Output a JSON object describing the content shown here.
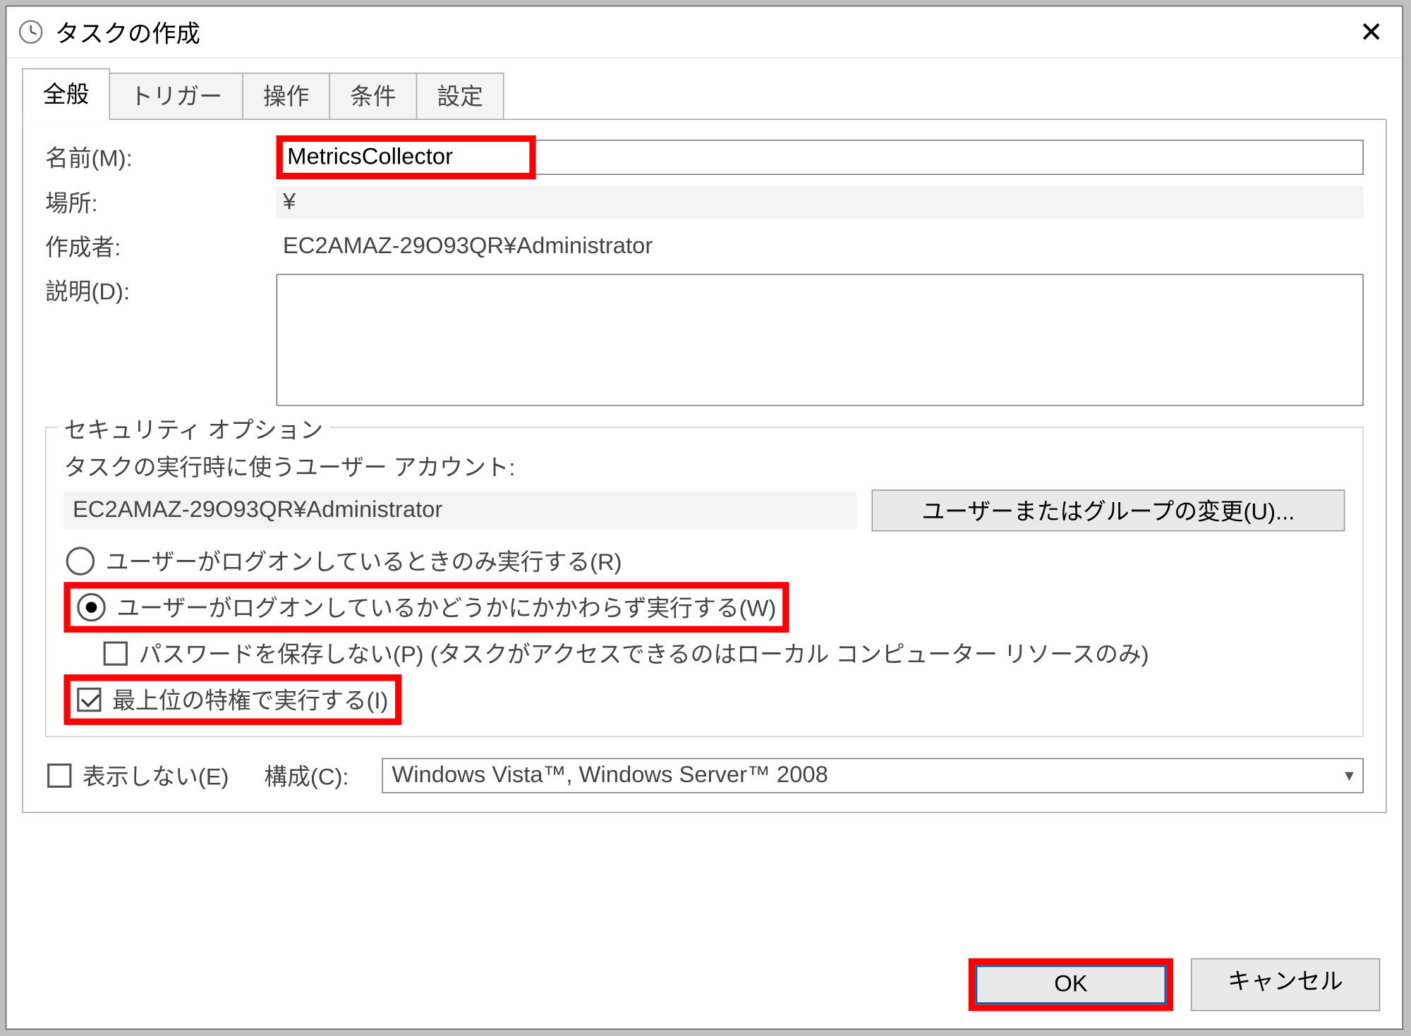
{
  "window": {
    "title": "タスクの作成"
  },
  "tabs": {
    "items": [
      "全般",
      "トリガー",
      "操作",
      "条件",
      "設定"
    ],
    "active_index": 0
  },
  "general": {
    "name": {
      "label": "名前(M):",
      "value": "MetricsCollector"
    },
    "location": {
      "label": "場所:",
      "value": "¥"
    },
    "author": {
      "label": "作成者:",
      "value": "EC2AMAZ-29O93QR¥Administrator"
    },
    "description": {
      "label": "説明(D):",
      "value": ""
    }
  },
  "security": {
    "legend": "セキュリティ オプション",
    "account_label": "タスクの実行時に使うユーザー アカウント:",
    "account_value": "EC2AMAZ-29O93QR¥Administrator",
    "change_user_button": "ユーザーまたはグループの変更(U)...",
    "run_only_logged_on": {
      "label": "ユーザーがログオンしているときのみ実行する(R)",
      "checked": false
    },
    "run_whether_logged_on": {
      "label": "ユーザーがログオンしているかどうかにかかわらず実行する(W)",
      "checked": true
    },
    "do_not_store_password": {
      "label": "パスワードを保存しない(P) (タスクがアクセスできるのはローカル コンピューター リソースのみ)",
      "checked": false
    },
    "run_highest_priv": {
      "label": "最上位の特権で実行する(I)",
      "checked": true
    }
  },
  "bottom": {
    "hidden": {
      "label": "表示しない(E)",
      "checked": false
    },
    "configure_for": {
      "label": "構成(C):",
      "value": "Windows Vista™, Windows Server™ 2008"
    }
  },
  "footer": {
    "ok": "OK",
    "cancel": "キャンセル"
  },
  "highlights": {
    "name_input": true,
    "run_whether_logged_on": true,
    "run_highest_priv": true,
    "ok_button": true
  },
  "colors": {
    "highlight": "#ff0000"
  }
}
